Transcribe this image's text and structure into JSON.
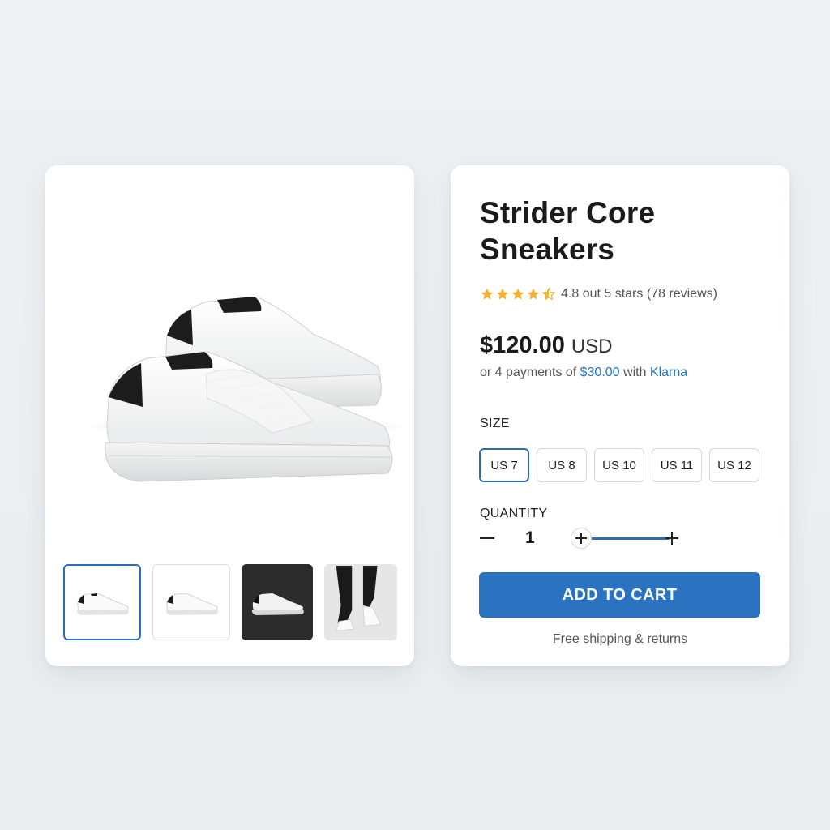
{
  "product": {
    "title": "Strider Core Sneakers",
    "rating_text": "4.8 out 5 stars (78 reviews)",
    "rating_value": 4.8,
    "rating_max": 5,
    "price_amount": "$120.00",
    "price_currency": "USD",
    "installments": {
      "prefix": "or 4 payments of ",
      "amount": "$30.00",
      "middle": " with ",
      "provider": "Klarna"
    }
  },
  "gallery": {
    "main_image_icon": "white-sneaker-pair-image",
    "thumbnails": [
      {
        "icon": "white-sneaker-thumbnail",
        "selected": true
      },
      {
        "icon": "white-sneaker-thumbnail",
        "selected": false
      },
      {
        "icon": "white-sneaker-dark-background-thumbnail",
        "selected": false
      },
      {
        "icon": "sneaker-on-feet-thumbnail",
        "selected": false
      }
    ]
  },
  "size": {
    "label": "SIZE",
    "options": [
      "US 7",
      "US 8",
      "US 10",
      "US 11",
      "US 12"
    ],
    "selected": "US 7"
  },
  "quantity": {
    "label": "QUANTITY",
    "value": "1"
  },
  "cart": {
    "button_label": "ADD TO CART",
    "shipping_note": "Free shipping & returns"
  },
  "colors": {
    "accent": "#2b72c0",
    "star": "#f2b233",
    "link": "#2474c0",
    "background": "#eef1f3"
  }
}
